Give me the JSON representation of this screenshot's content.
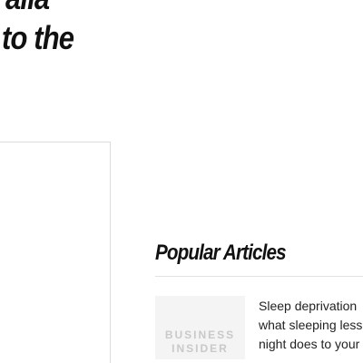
{
  "headline": {
    "line1": "aiia",
    "line2": "to the"
  },
  "popular": {
    "title": "Popular Articles",
    "articles": [
      {
        "thumbnail_logo": {
          "line1": "BUSINESS",
          "line2": "INSIDER"
        },
        "title_lines": [
          "Sleep deprivation",
          "what sleeping less",
          "night does to your"
        ]
      }
    ]
  }
}
